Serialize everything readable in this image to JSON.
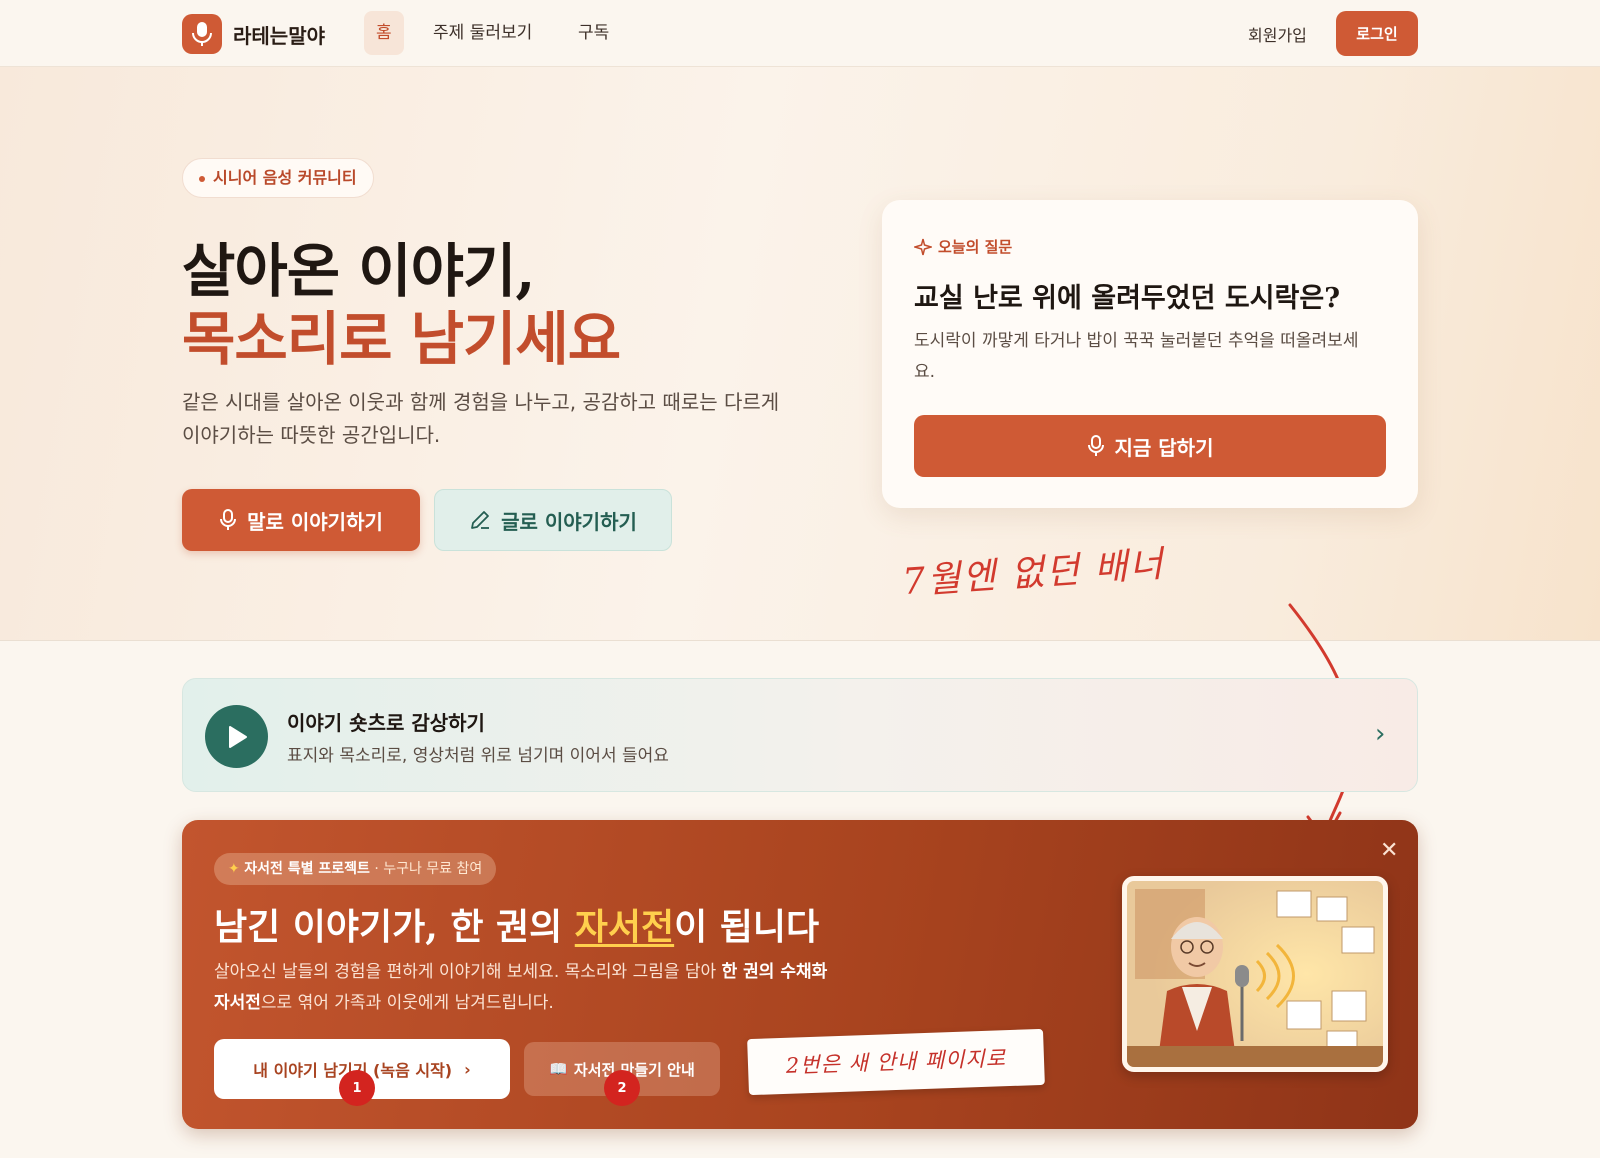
{
  "nav": {
    "brand": "라테는말야",
    "items": [
      {
        "label": "홈",
        "active": true
      },
      {
        "label": "주제 둘러보기",
        "active": false
      },
      {
        "label": "구독",
        "active": false
      }
    ],
    "signup": "회원가입",
    "login": "로그인"
  },
  "hero": {
    "pill": "시니어 음성 커뮤니티",
    "title_line1": "살아온 이야기,",
    "title_line2": "목소리로 남기세요",
    "description": "같은 시대를 살아온 이웃과 함께 경험을 나누고, 공감하고 때로는 다르게 이야기하는 따뜻한 공간입니다.",
    "btn_voice": "말로 이야기하기",
    "btn_text": "글로 이야기하기"
  },
  "question": {
    "label": "오늘의 질문",
    "title": "교실 난로 위에 올려두었던 도시락은?",
    "description": "도시락이 까맣게 타거나 밥이 꾹꾹 눌러붙던 추억을 떠올려보세요.",
    "button": "지금 답하기"
  },
  "annotations": {
    "top_note": "7월엔 없던 배너",
    "bottom_note": "2번은 새 안내 페이지로",
    "badge1": "1",
    "badge2": "2"
  },
  "shorts": {
    "title": "이야기 숏츠로 감상하기",
    "subtitle": "표지와 목소리로, 영상처럼 위로 넘기며 이어서 들어요"
  },
  "autobio": {
    "tag_bold": "자서전 특별 프로젝트",
    "tag_rest": "· 누구나 무료 참여",
    "title_pre": "남긴 이야기가, 한 권의 ",
    "title_hl": "자서전",
    "title_post": "이 됩니다",
    "desc_pre": "살아오신 날들의 경험을 편하게 이야기해 보세요. 목소리와 그림을 담아 ",
    "desc_bold": "한 권의 수채화 자서전",
    "desc_post": "으로 엮어 가족과 이웃에게 남겨드립니다.",
    "btn_primary": "내 이야기 남기기 (녹음 시작)",
    "btn_secondary": "자서전 만들기 안내",
    "close": "✕"
  },
  "colors": {
    "accent": "#cf5a35",
    "teal": "#2b6e60",
    "banner_bg": "#a9441f",
    "highlight": "#ffcf4d",
    "annotation_red": "#d23a2e"
  }
}
